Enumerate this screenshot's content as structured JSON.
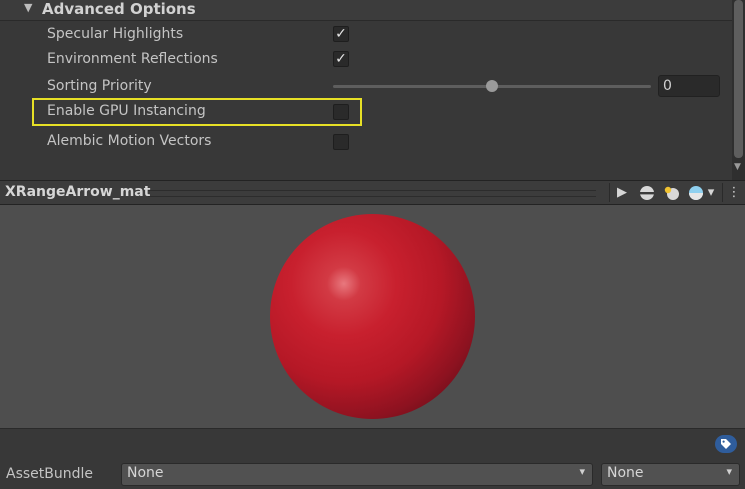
{
  "inspector": {
    "section_title": "Advanced Options",
    "properties": [
      {
        "label": "Specular Highlights",
        "checked": true
      },
      {
        "label": "Environment Reflections",
        "checked": true
      },
      {
        "label": "Sorting Priority",
        "value": "0"
      },
      {
        "label": "Enable GPU Instancing",
        "checked": false
      },
      {
        "label": "Alembic Motion Vectors",
        "checked": false
      }
    ],
    "sorting_priority_slider_fraction": 0.5,
    "check_glyph": "✓",
    "highlight_color": "#e7e026"
  },
  "preview": {
    "title": "XRangeArrow_mat",
    "toolbar": {
      "play_icon": "▶",
      "mesh_icon": "sphere-mesh-icon",
      "light_icon": "lighting-icon",
      "skybox_icon": "skybox-icon",
      "skybox_arrow": "▾",
      "menu_icon": "⋮"
    },
    "sphere_color": "#c8202e"
  },
  "asset_bundle": {
    "label": "AssetBundle",
    "name_value": "None",
    "variant_value": "None",
    "dropdown_arrow": "▾"
  },
  "colors": {
    "background": "#383838",
    "preview_background": "#4e4e4e",
    "tag_blue": "#2f5d9c"
  }
}
